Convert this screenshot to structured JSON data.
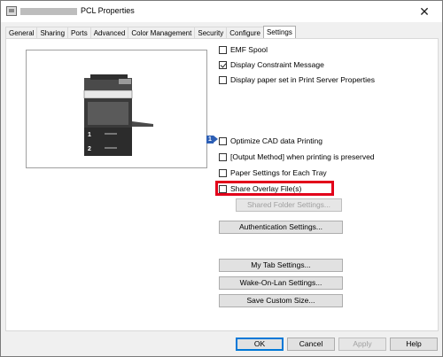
{
  "window": {
    "title": "PCL Properties"
  },
  "tabs": [
    {
      "label": "General"
    },
    {
      "label": "Sharing"
    },
    {
      "label": "Ports"
    },
    {
      "label": "Advanced"
    },
    {
      "label": "Color Management"
    },
    {
      "label": "Security"
    },
    {
      "label": "Configure"
    },
    {
      "label": "Settings",
      "active": true
    }
  ],
  "settings": {
    "checkboxes": {
      "emf_spool": {
        "label": "EMF Spool",
        "checked": false
      },
      "display_constraint": {
        "label": "Display Constraint Message",
        "checked": true
      },
      "display_paper_set": {
        "label": "Display paper set in Print Server Properties",
        "checked": false
      },
      "optimize_cad": {
        "label": "Optimize CAD data Printing",
        "checked": false
      },
      "output_method": {
        "label": "[Output Method] when printing is preserved",
        "checked": false
      },
      "paper_settings": {
        "label": "Paper Settings for Each Tray",
        "checked": false
      },
      "share_overlay": {
        "label": "Share Overlay File(s)",
        "checked": false
      }
    },
    "badge_number": "1",
    "tray_labels": [
      "1",
      "2"
    ],
    "buttons": {
      "shared_folder": "Shared Folder Settings...",
      "authentication": "Authentication Settings...",
      "my_tab": "My Tab Settings...",
      "wake_on_lan": "Wake-On-Lan Settings...",
      "save_custom_size": "Save Custom Size..."
    }
  },
  "footer": {
    "ok": "OK",
    "cancel": "Cancel",
    "apply": "Apply",
    "help": "Help"
  },
  "colors": {
    "highlight": "#e2001a",
    "badge": "#2d5fb5"
  }
}
